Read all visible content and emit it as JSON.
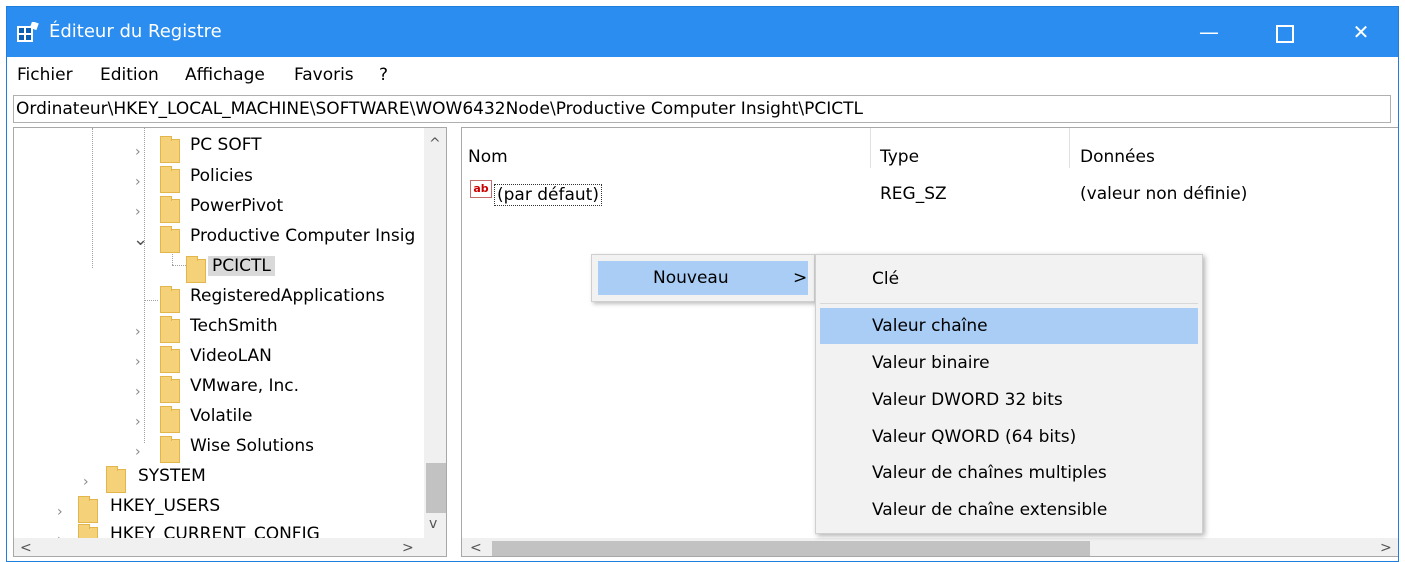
{
  "window": {
    "title": "Éditeur du Registre",
    "minimize": "—",
    "close": "✕"
  },
  "menu": [
    "Fichier",
    "Edition",
    "Affichage",
    "Favoris",
    "?"
  ],
  "address": "Ordinateur\\HKEY_LOCAL_MACHINE\\SOFTWARE\\WOW6432Node\\Productive Computer Insight\\PCICTL",
  "tree": {
    "items": [
      {
        "label": "PC SOFT",
        "expander": "›"
      },
      {
        "label": "Policies",
        "expander": "›"
      },
      {
        "label": "PowerPivot",
        "expander": "›"
      },
      {
        "label": "Productive Computer Insig",
        "expander": "⌄"
      },
      {
        "label": "PCICTL",
        "expander": ""
      },
      {
        "label": "RegisteredApplications",
        "expander": ""
      },
      {
        "label": "TechSmith",
        "expander": "›"
      },
      {
        "label": "VideoLAN",
        "expander": "›"
      },
      {
        "label": "VMware, Inc.",
        "expander": "›"
      },
      {
        "label": "Volatile",
        "expander": "›"
      },
      {
        "label": "Wise Solutions",
        "expander": "›"
      },
      {
        "label": "SYSTEM",
        "expander": "›"
      },
      {
        "label": "HKEY_USERS",
        "expander": "›"
      },
      {
        "label": "HKEY_CURRENT_CONFIG",
        "expander": "›"
      }
    ],
    "scroll_up": "^",
    "scroll_down": "v",
    "scroll_left": "<",
    "scroll_right": ">"
  },
  "list": {
    "columns": [
      "Nom",
      "Type",
      "Données"
    ],
    "rows": [
      {
        "icon": "ab",
        "name": "(par défaut)",
        "type": "REG_SZ",
        "data": "(valeur non définie)"
      }
    ],
    "scroll_left": "<",
    "scroll_right": ">"
  },
  "context_menu": {
    "item": "Nouveau",
    "arrow": ">"
  },
  "submenu": {
    "items": [
      "Clé",
      "Valeur chaîne",
      "Valeur binaire",
      "Valeur DWORD 32 bits",
      "Valeur QWORD (64 bits)",
      "Valeur de chaînes multiples",
      "Valeur de chaîne extensible"
    ],
    "highlighted": "Valeur chaîne"
  },
  "colors": {
    "titlebar": "#2b8df0",
    "highlight": "#a9cdf5",
    "folder": "#f5d27a"
  }
}
